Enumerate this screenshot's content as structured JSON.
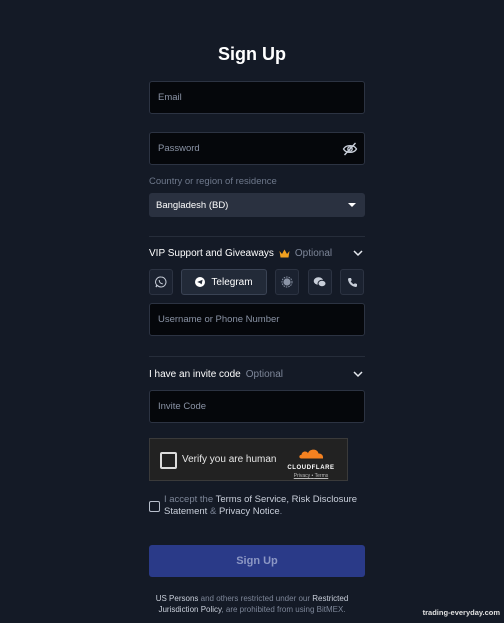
{
  "title": "Sign Up",
  "email": {
    "placeholder": "Email"
  },
  "password": {
    "placeholder": "Password"
  },
  "country": {
    "label": "Country or region of residence",
    "selected": "Bangladesh (BD)"
  },
  "vip": {
    "heading": "VIP Support and Giveaways",
    "optional": "Optional",
    "channels": [
      "whatsapp-icon",
      "telegram",
      "signal-icon",
      "wechat-icon",
      "phone-icon"
    ],
    "telegram_label": "Telegram",
    "contact_placeholder": "Username or Phone Number"
  },
  "invite": {
    "heading": "I have an invite code",
    "optional": "Optional",
    "placeholder": "Invite Code"
  },
  "captcha": {
    "text": "Verify you are human",
    "brand": "CLOUDFLARE",
    "privacy": "Privacy",
    "sep": "•",
    "terms": "Terms"
  },
  "agreement": {
    "prefix": "I accept the",
    "tos": "Terms of Service",
    "comma": ",",
    "risk": "Risk Disclosure Statement",
    "amp": "&",
    "privacy": "Privacy Notice",
    "period": "."
  },
  "submit_label": "Sign Up",
  "footer": {
    "us": "US Persons",
    "middle": "and others restricted under our",
    "policy": "Restricted Jurisdiction Policy",
    "end": ", are prohibited from using BitMEX."
  },
  "watermark": "trading-everyday.com",
  "colors": {
    "background": "#141a26",
    "button": "#2a3a88",
    "crown": "#f0a020",
    "cloudflare": "#f48120"
  }
}
